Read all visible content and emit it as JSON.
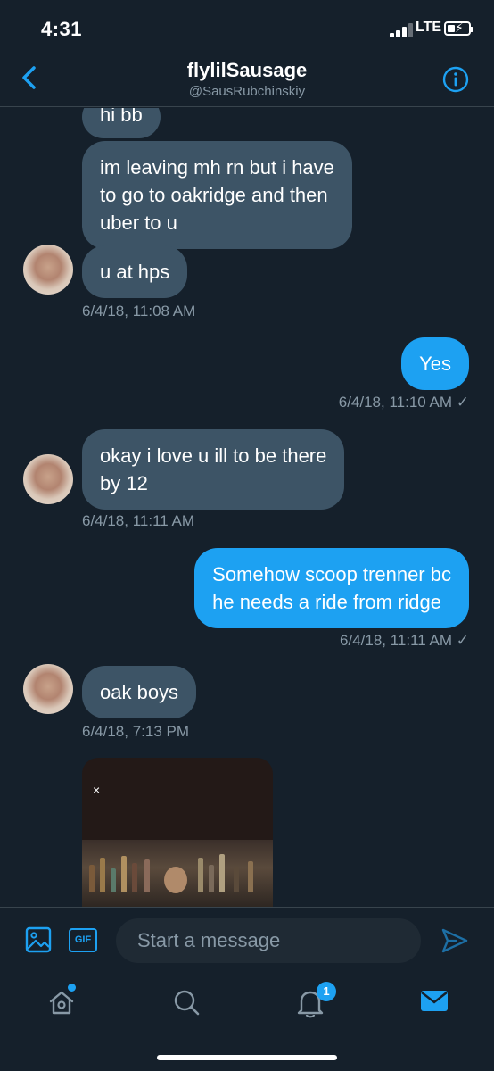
{
  "status_bar": {
    "time": "4:31",
    "network": "LTE"
  },
  "header": {
    "name": "flylilSausage",
    "handle": "@SausRubchinskiy"
  },
  "messages": [
    {
      "direction": "received",
      "text": "hi bb"
    },
    {
      "direction": "received",
      "text": "im leaving mh rn but i have\nto go to oakridge and then\nuber to u"
    },
    {
      "direction": "received",
      "text": "u at hps"
    },
    {
      "timestamp": "6/4/18, 11:08 AM"
    },
    {
      "direction": "sent",
      "text": "Yes"
    },
    {
      "timestamp": "6/4/18, 11:10 AM ✓"
    },
    {
      "direction": "received",
      "text": "okay i love u ill to be there\nby 12"
    },
    {
      "timestamp": "6/4/18, 11:11 AM"
    },
    {
      "direction": "sent",
      "text": "Somehow scoop trenner bc\nhe needs a ride from ridge"
    },
    {
      "timestamp": "6/4/18, 11:11 AM ✓"
    },
    {
      "direction": "received",
      "text": "oak boys"
    },
    {
      "timestamp": "6/4/18, 7:13 PM"
    }
  ],
  "media": {
    "close_glyph": "×"
  },
  "compose": {
    "placeholder": "Start a message",
    "gif_label": "GIF"
  },
  "tabbar": {
    "notifications_badge": "1"
  },
  "colors": {
    "background": "#15202b",
    "received_bubble": "#3d5466",
    "sent_bubble": "#1da1f2",
    "accent": "#1da1f2",
    "muted_text": "#8899a6"
  }
}
